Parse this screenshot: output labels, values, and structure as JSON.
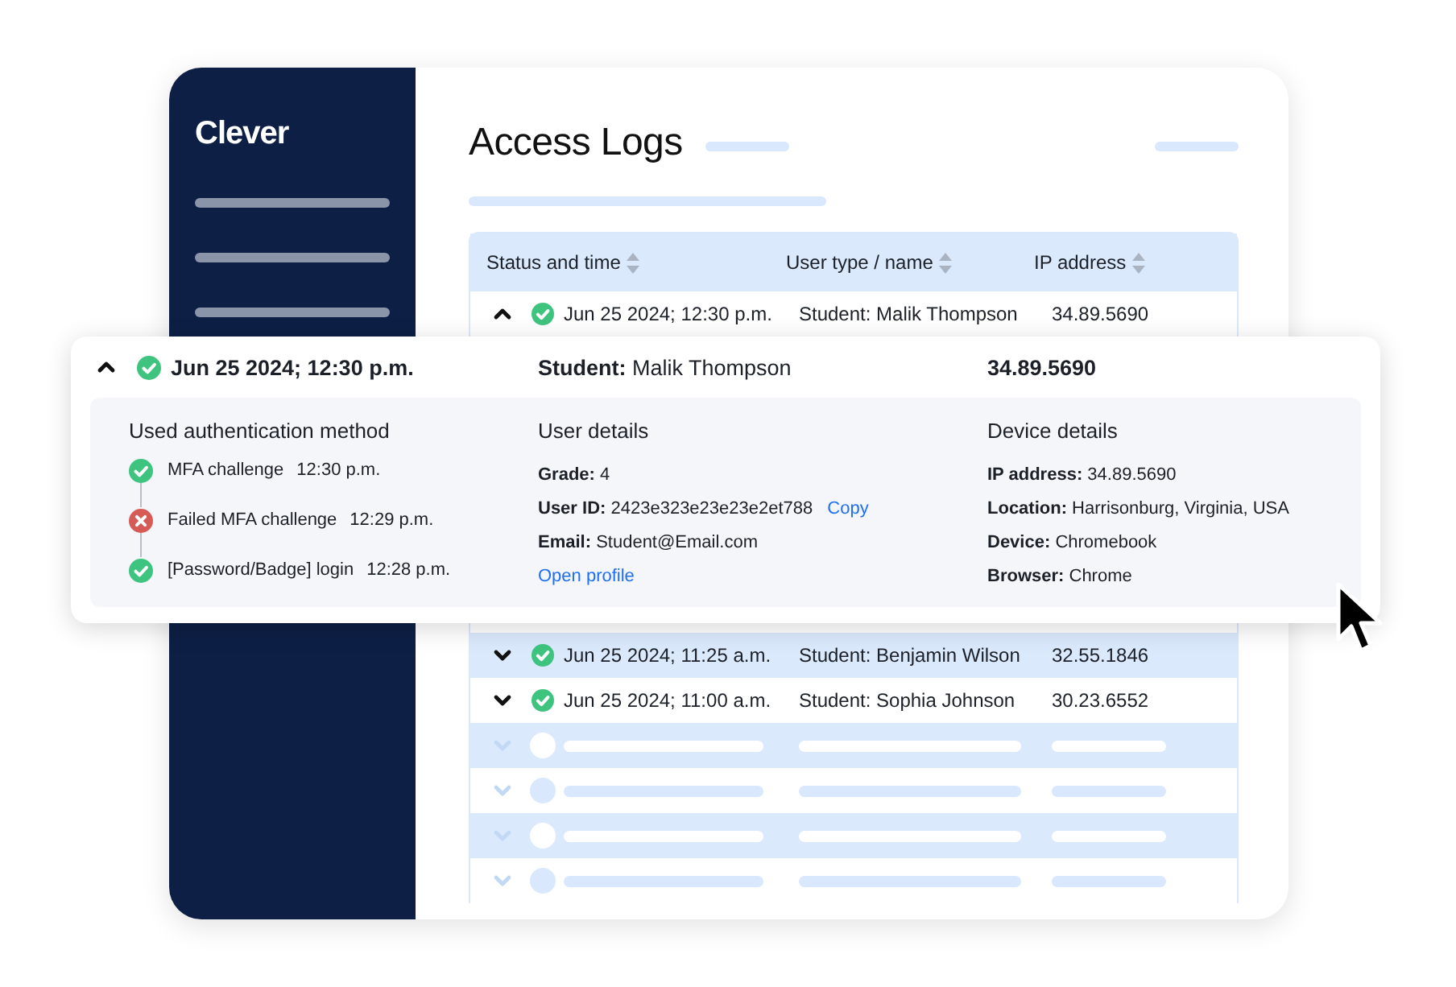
{
  "sidebar": {
    "logo": "Clever",
    "items": [
      {
        "kind": "placeholder"
      },
      {
        "kind": "placeholder"
      },
      {
        "kind": "placeholder"
      }
    ]
  },
  "page": {
    "title": "Access Logs"
  },
  "table": {
    "columns": [
      {
        "label": "Status and time",
        "sortable": true
      },
      {
        "label": "User type / name",
        "sortable": true
      },
      {
        "label": "IP address",
        "sortable": true
      }
    ],
    "rows": [
      {
        "kind": "entry",
        "expanded": true,
        "failed": false,
        "time": "Jun 25 2024; 12:30 p.m.",
        "user": "Student: Malik Thompson",
        "ip": "34.89.5690"
      },
      {
        "kind": "entry",
        "expanded": false,
        "failed": false,
        "time": "Jun 25 2024; 11:25 a.m.",
        "user": "Student: Benjamin Wilson",
        "ip": "32.55.1846"
      },
      {
        "kind": "entry",
        "expanded": false,
        "failed": false,
        "time": "Jun 25 2024; 11:00 a.m.",
        "user": "Student: Sophia Johnson",
        "ip": "30.23.6552"
      },
      {
        "kind": "skeleton"
      },
      {
        "kind": "skeleton"
      },
      {
        "kind": "skeleton"
      },
      {
        "kind": "skeleton"
      }
    ]
  },
  "detail_popup": {
    "expanded": true,
    "failed": false,
    "time": "Jun 25 2024; 12:30 p.m.",
    "user": "**Student:** Malik Thompson",
    "ip": "34.89.5690",
    "sections": [
      {
        "kind": "steps",
        "title": "Used authentication method",
        "steps": [
          {
            "failed": false,
            "label": "MFA challenge",
            "time": "12:30 p.m."
          },
          {
            "failed": true,
            "label": "Failed MFA challenge",
            "time": "12:29 p.m."
          },
          {
            "failed": false,
            "label": "[Password/Badge] login",
            "time": "12:28 p.m."
          }
        ]
      },
      {
        "kind": "fields",
        "title": "User details",
        "fields": [
          {
            "kind": "text",
            "text": "**Grade:** 4"
          },
          {
            "kind": "text",
            "text": "**User ID:** 2423e323e23e23e2et788",
            "action": "Copy"
          },
          {
            "kind": "text",
            "text": "**Email:** Student@Email.com"
          },
          {
            "kind": "link",
            "text": "Open profile"
          }
        ]
      },
      {
        "kind": "fields",
        "title": "Device details",
        "fields": [
          {
            "kind": "text",
            "text": "**IP address:** 34.89.5690"
          },
          {
            "kind": "text",
            "text": "**Location:** Harrisonburg, Virginia, USA"
          },
          {
            "kind": "text",
            "text": "**Device:** Chromebook"
          },
          {
            "kind": "text",
            "text": "**Browser:** Chrome"
          }
        ]
      }
    ]
  }
}
